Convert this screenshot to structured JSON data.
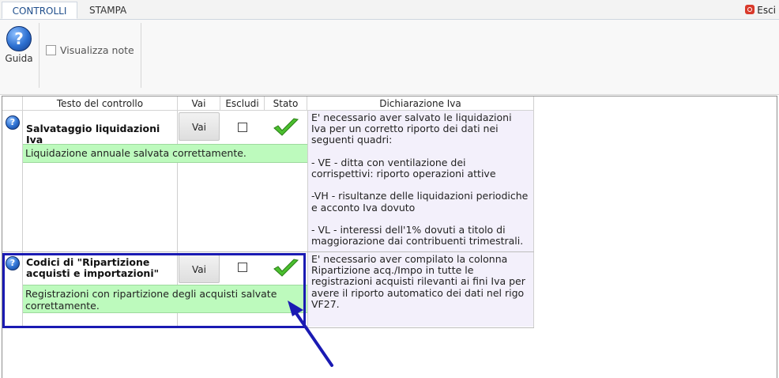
{
  "tabs": [
    {
      "label": "CONTROLLI",
      "active": true
    },
    {
      "label": "STAMPA",
      "active": false
    }
  ],
  "exit": {
    "label": "Esci",
    "icon": "power-icon"
  },
  "ribbon": {
    "guida_label": "Guida",
    "guida_icon": "help-icon",
    "visualizza_note_label": "Visualizza note",
    "visualizza_note_checked": false
  },
  "grid": {
    "headers": {
      "testo": "Testo del controllo",
      "vai": "Vai",
      "escludi": "Escludi",
      "stato": "Stato",
      "dichiarazione": "Dichiarazione Iva"
    },
    "rows": [
      {
        "title": "Salvataggio liquidazioni Iva",
        "vai_label": "Vai",
        "escludi_checked": false,
        "stato": "ok",
        "stato_icon": "green-check-icon",
        "result": "Liquidazione annuale salvata correttamente.",
        "dichiarazione": "E' necessario aver salvato le liquidazioni\nIva per un corretto riporto dei dati nei\nseguenti quadri:\n\n- VE - ditta con ventilazione dei\ncorrispettivi: riporto operazioni attive\n\n-VH - risultanze delle liquidazioni periodiche\ne acconto Iva dovuto\n\n- VL - interessi dell'1% dovuti a titolo di\nmaggiorazione dai contribuenti trimestrali."
      },
      {
        "title": "Codici di \"Ripartizione\nacquisti e importazioni\"",
        "vai_label": "Vai",
        "escludi_checked": false,
        "stato": "ok",
        "stato_icon": "green-check-icon",
        "result": "Registrazioni con ripartizione degli acquisti salvate correttamente.",
        "dichiarazione": "E' necessario aver compilato la colonna\nRipartizione acq./Impo in tutte le\nregistrazioni acquisti rilevanti ai fini Iva per\navere il riporto automatico dei dati nel rigo\nVF27."
      }
    ]
  },
  "colors": {
    "result_bg": "#bdfabd",
    "dichiarazione_bg": "#f3f0fb",
    "highlight": "#1a1ab3",
    "tab_active_text": "#1f4e8c"
  }
}
